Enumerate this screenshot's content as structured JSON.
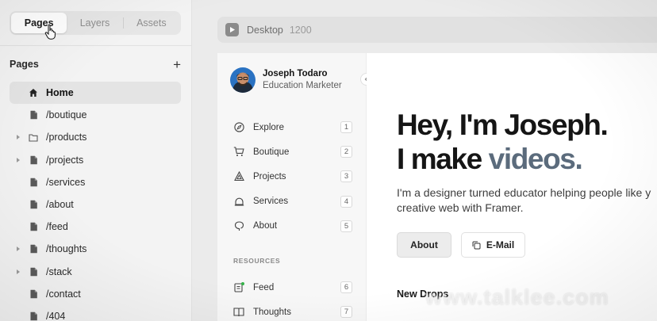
{
  "left_panel": {
    "tabs": [
      {
        "label": "Pages"
      },
      {
        "label": "Layers"
      },
      {
        "label": "Assets"
      }
    ],
    "section_title": "Pages",
    "add_label": "+",
    "pages": [
      {
        "label": "Home",
        "icon": "home-icon",
        "caret": false,
        "active": true
      },
      {
        "label": "/boutique",
        "icon": "file-icon",
        "caret": false
      },
      {
        "label": "/products",
        "icon": "folder-icon",
        "caret": true
      },
      {
        "label": "/projects",
        "icon": "file-icon",
        "caret": true
      },
      {
        "label": "/services",
        "icon": "file-icon",
        "caret": false
      },
      {
        "label": "/about",
        "icon": "file-icon",
        "caret": false
      },
      {
        "label": "/feed",
        "icon": "file-icon",
        "caret": false
      },
      {
        "label": "/thoughts",
        "icon": "file-icon",
        "caret": true
      },
      {
        "label": "/stack",
        "icon": "file-icon",
        "caret": true
      },
      {
        "label": "/contact",
        "icon": "file-icon",
        "caret": false
      },
      {
        "label": "/404",
        "icon": "file-icon",
        "caret": false
      }
    ]
  },
  "canvas": {
    "frame_name": "Desktop",
    "frame_size": "1200"
  },
  "site": {
    "profile": {
      "name": "Joseph Todaro",
      "role": "Education Marketer"
    },
    "nav": [
      {
        "label": "Explore",
        "num": "1",
        "icon": "compass-icon"
      },
      {
        "label": "Boutique",
        "num": "2",
        "icon": "cart-icon"
      },
      {
        "label": "Projects",
        "num": "3",
        "icon": "projects-icon"
      },
      {
        "label": "Services",
        "num": "4",
        "icon": "bell-icon"
      },
      {
        "label": "About",
        "num": "5",
        "icon": "about-icon"
      }
    ],
    "resources_title": "RESOURCES",
    "resources": [
      {
        "label": "Feed",
        "num": "6",
        "icon": "feed-icon"
      },
      {
        "label": "Thoughts",
        "num": "7",
        "icon": "thoughts-icon"
      }
    ],
    "hero_line1": "Hey, I'm Joseph.",
    "hero_line2_a": "I make ",
    "hero_line2_b": "videos.",
    "desc_line1": "I'm a designer turned educator helping people like y",
    "desc_line2": "creative web with Framer.",
    "btn_about": "About",
    "btn_mail": "E-Mail",
    "new_drops": "New Drops"
  },
  "watermark": "www.talklee.com",
  "colors": {
    "accent_text": "#5b6b7c"
  }
}
